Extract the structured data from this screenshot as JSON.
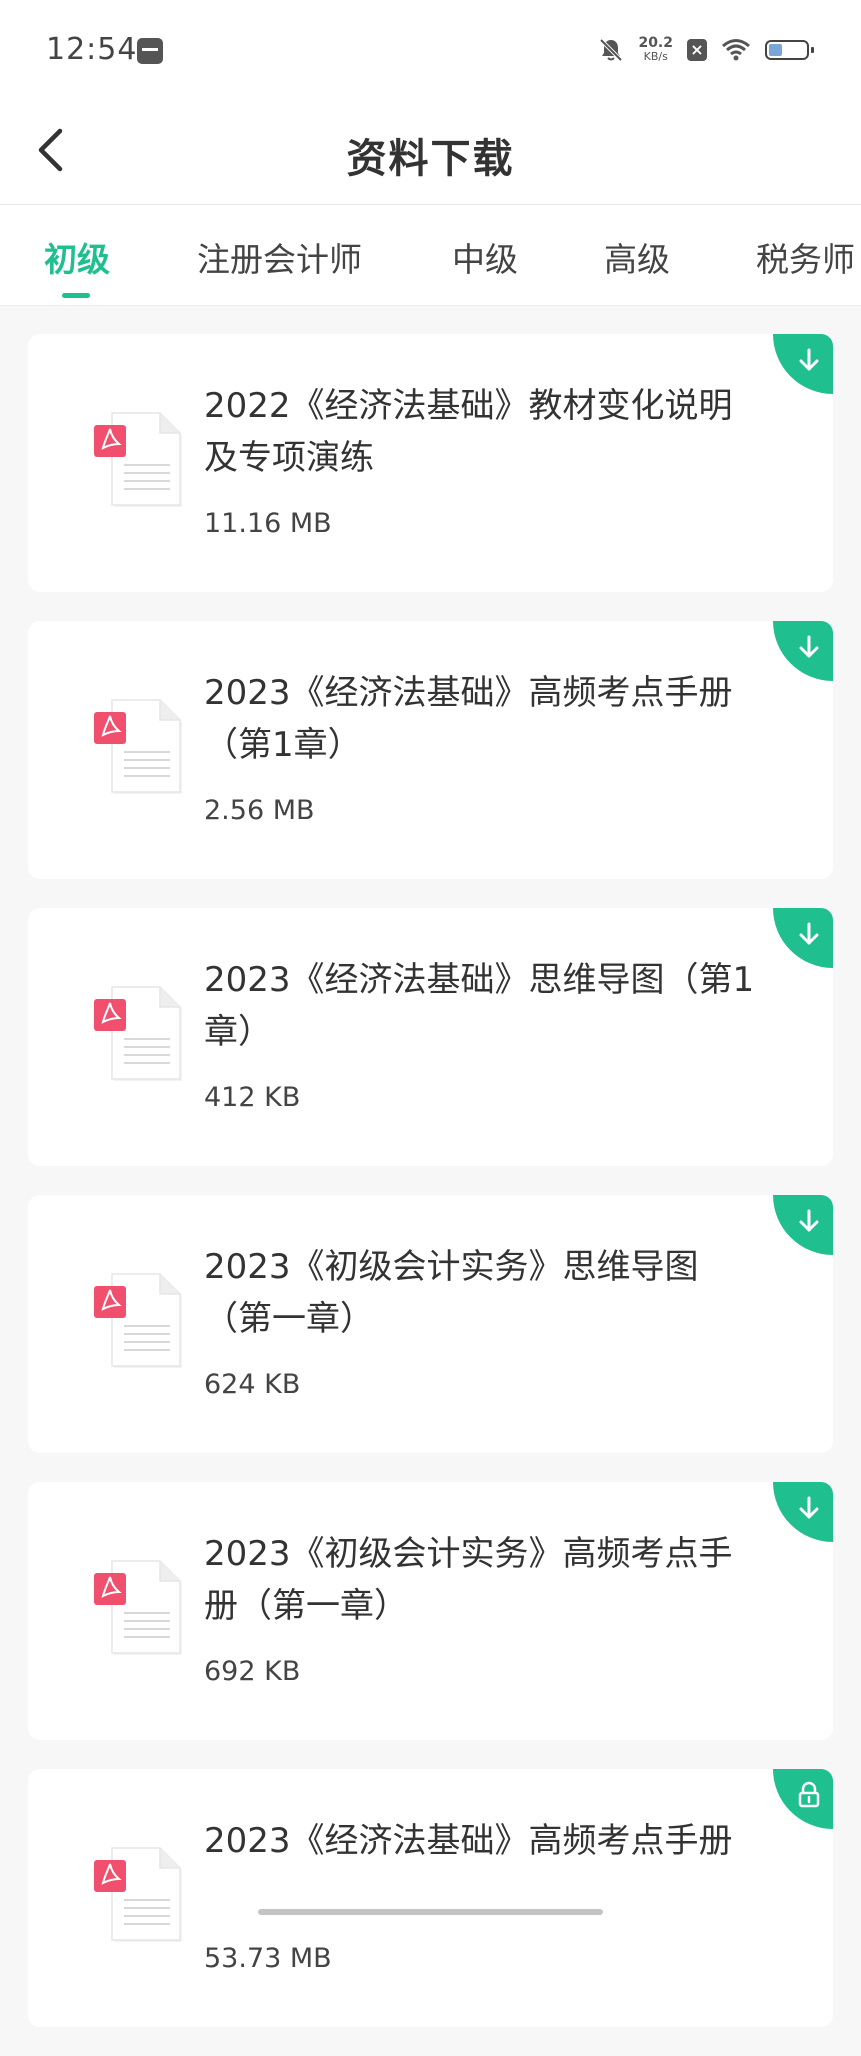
{
  "status_bar": {
    "time": "12:54",
    "speed_value": "20.2",
    "speed_unit": "KB/s",
    "battery_level": 0.35
  },
  "header": {
    "title": "资料下载"
  },
  "tabs": [
    {
      "label": "初级",
      "active": true
    },
    {
      "label": "注册会计师",
      "active": false
    },
    {
      "label": "中级",
      "active": false
    },
    {
      "label": "高级",
      "active": false
    },
    {
      "label": "税务师",
      "active": false
    }
  ],
  "documents": [
    {
      "title": "2022《经济法基础》教材变化说明及专项演练",
      "size": "11.16 MB",
      "action_icon": "download-icon"
    },
    {
      "title": "2023《经济法基础》高频考点手册（第1章）",
      "size": "2.56 MB",
      "action_icon": "download-icon"
    },
    {
      "title": "2023《经济法基础》思维导图（第1章）",
      "size": "412 KB",
      "action_icon": "download-icon"
    },
    {
      "title": "2023《初级会计实务》思维导图（第一章）",
      "size": "624 KB",
      "action_icon": "download-icon"
    },
    {
      "title": "2023《初级会计实务》高频考点手册（第一章）",
      "size": "692 KB",
      "action_icon": "download-icon"
    },
    {
      "title": "2023《经济法基础》高频考点手册",
      "size": "53.73 MB",
      "action_icon": "lock-icon"
    }
  ],
  "colors": {
    "accent": "#1fbf8f",
    "pdf_red": "#f0506e",
    "background": "#f7f7f7"
  }
}
